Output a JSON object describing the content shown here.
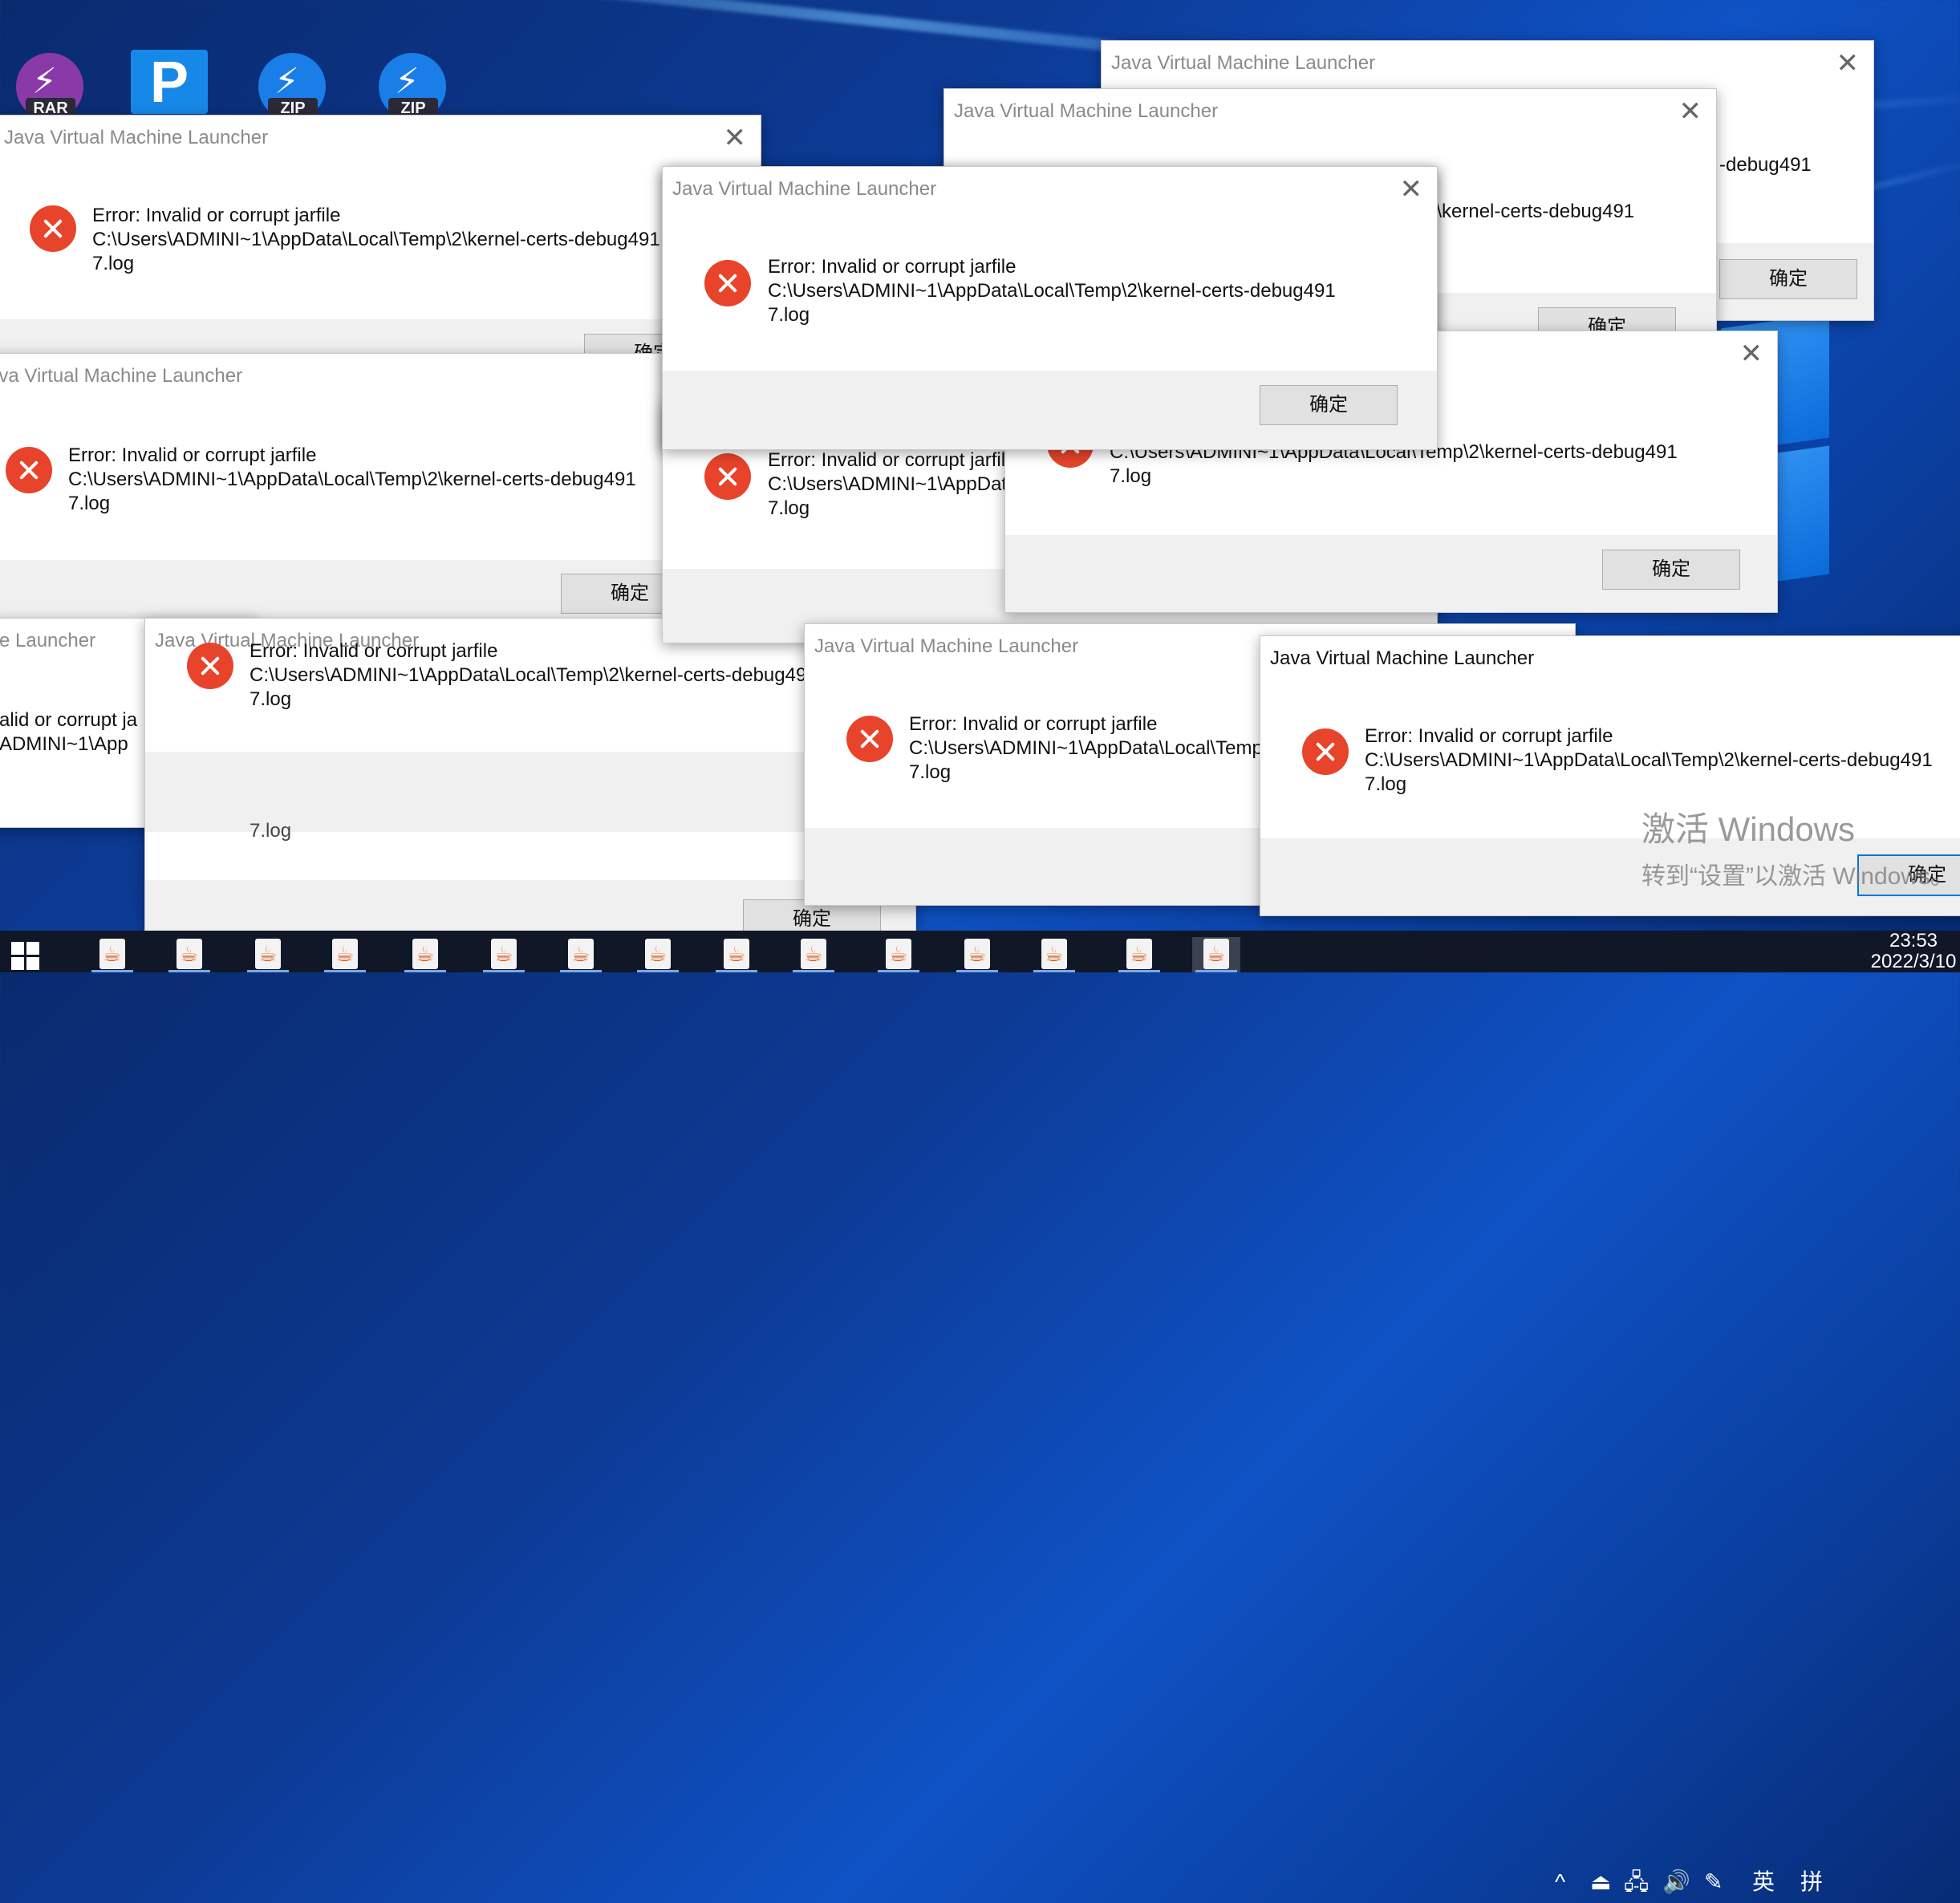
{
  "desktop": {
    "icons": [
      {
        "name": "rar-archive-icon",
        "badge": "RAR",
        "color": "#8a3aa8"
      },
      {
        "name": "p-app-icon",
        "badge": "P",
        "color": "#1688e8"
      },
      {
        "name": "zip-archive-icon",
        "badge": "ZIP",
        "color": "#1a7ee8"
      },
      {
        "name": "zip-archive-icon",
        "badge": "ZIP",
        "color": "#1a7ee8"
      }
    ]
  },
  "dialog": {
    "title": "Java Virtual Machine Launcher",
    "error_line1": "Error: Invalid or corrupt jarfile",
    "error_line2": "C:\\Users\\ADMINI~1\\AppData\\Local\\Temp\\2\\kernel-certs-debug491",
    "error_line3": "7.log",
    "ok_label": "确定",
    "close_glyph": "✕"
  },
  "fragments": {
    "title_partial": "e Launcher",
    "err_partial": "alid or corrupt ja",
    "path_partial": "ADMINI~1\\App",
    "debug_partial": "-debug491",
    "kernel_partial": "2\\kernel-certs-debug491"
  },
  "watermark": {
    "line1": "激活 Windows",
    "line2": "转到“设置”以激活 Windows。"
  },
  "taskbar": {
    "app_icon": "java-icon",
    "app_count": 15,
    "tray_chevron": "^",
    "ime_lang": "英",
    "ime_mode": "拼",
    "time": "23:53",
    "date": "2022/3/10"
  }
}
